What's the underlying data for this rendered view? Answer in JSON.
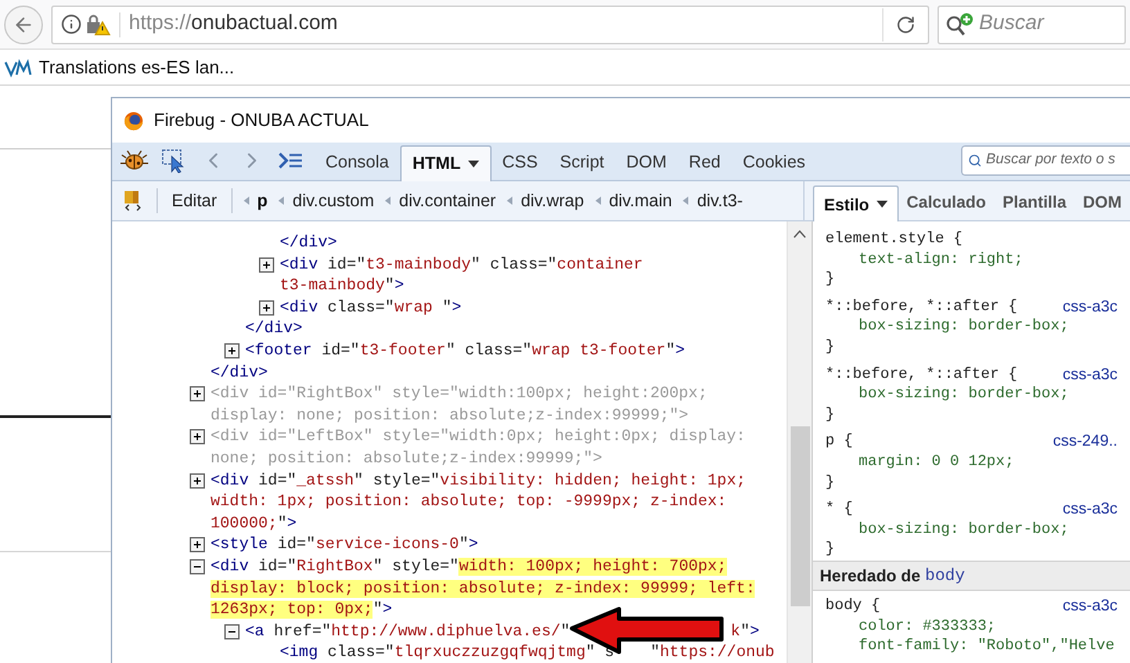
{
  "browser": {
    "url": {
      "scheme": "https://",
      "host": "onubactual.com"
    },
    "search": {
      "placeholder": "Buscar"
    },
    "bookmarks": [
      {
        "label": "Translations es-ES lan..."
      }
    ]
  },
  "firebug": {
    "title": "Firebug - ONUBA ACTUAL",
    "tabs": [
      {
        "label": "Consola",
        "selected": false,
        "dropdown": false
      },
      {
        "label": "HTML",
        "selected": true,
        "dropdown": true
      },
      {
        "label": "CSS",
        "selected": false,
        "dropdown": false
      },
      {
        "label": "Script",
        "selected": false,
        "dropdown": false
      },
      {
        "label": "DOM",
        "selected": false,
        "dropdown": false
      },
      {
        "label": "Red",
        "selected": false,
        "dropdown": false
      },
      {
        "label": "Cookies",
        "selected": false,
        "dropdown": false
      }
    ],
    "edit_button": "Editar",
    "breadcrumbs": [
      {
        "label": "p",
        "selected": true
      },
      {
        "label": "div.custom",
        "selected": false
      },
      {
        "label": "div.container",
        "selected": false
      },
      {
        "label": "div.wrap",
        "selected": false
      },
      {
        "label": "div.main",
        "selected": false
      },
      {
        "label": "div.t3-",
        "selected": false
      }
    ],
    "html_tree": [
      {
        "children": [
          {
            "children": [
              {
                "children": [
                  {
                    "lines": [
                      {
                        "segments": [
                          {
                            "kind": "tag",
                            "text": "</div>"
                          }
                        ]
                      }
                    ]
                  },
                  {
                    "expanded": false,
                    "lines": [
                      {
                        "segments": [
                          {
                            "kind": "tag",
                            "text": "<div"
                          },
                          {
                            "kind": "attr",
                            "text": " id=\""
                          },
                          {
                            "kind": "value",
                            "text": "t3-mainbody"
                          },
                          {
                            "kind": "attr",
                            "text": "\" class=\""
                          },
                          {
                            "kind": "value",
                            "text": "container"
                          }
                        ]
                      },
                      {
                        "segments": [
                          {
                            "kind": "value",
                            "text": "t3-mainbody"
                          },
                          {
                            "kind": "attr",
                            "text": "\""
                          },
                          {
                            "kind": "tag",
                            "text": ">"
                          }
                        ]
                      }
                    ]
                  },
                  {
                    "expanded": false,
                    "lines": [
                      {
                        "segments": [
                          {
                            "kind": "tag",
                            "text": "<div"
                          },
                          {
                            "kind": "attr",
                            "text": " class=\""
                          },
                          {
                            "kind": "value",
                            "text": "wrap "
                          },
                          {
                            "kind": "attr",
                            "text": "\""
                          },
                          {
                            "kind": "tag",
                            "text": ">"
                          }
                        ]
                      }
                    ]
                  }
                ]
              },
              {
                "lines": [
                  {
                    "segments": [
                      {
                        "kind": "tag",
                        "text": "</div>"
                      }
                    ]
                  }
                ]
              },
              {
                "expanded": false,
                "lines": [
                  {
                    "segments": [
                      {
                        "kind": "tag",
                        "text": "<footer"
                      },
                      {
                        "kind": "attr",
                        "text": " id=\""
                      },
                      {
                        "kind": "value",
                        "text": "t3-footer"
                      },
                      {
                        "kind": "attr",
                        "text": "\" class=\""
                      },
                      {
                        "kind": "value",
                        "text": "wrap t3-footer"
                      },
                      {
                        "kind": "attr",
                        "text": "\""
                      },
                      {
                        "kind": "tag",
                        "text": ">"
                      }
                    ]
                  }
                ]
              }
            ]
          },
          {
            "lines": [
              {
                "segments": [
                  {
                    "kind": "tag",
                    "text": "</div>"
                  }
                ]
              }
            ]
          },
          {
            "expanded": false,
            "lines": [
              {
                "segments": [
                  {
                    "kind": "muted",
                    "text": "<div id=\"RightBox\" style=\"width:100px; height:200px;"
                  }
                ]
              },
              {
                "segments": [
                  {
                    "kind": "muted",
                    "text": "display: none; position: absolute;z-index:99999;\">"
                  }
                ]
              }
            ]
          },
          {
            "expanded": false,
            "lines": [
              {
                "segments": [
                  {
                    "kind": "muted",
                    "text": "<div id=\"LeftBox\" style=\"width:0px; height:0px; display:"
                  }
                ]
              },
              {
                "segments": [
                  {
                    "kind": "muted",
                    "text": "none; position: absolute;z-index:99999;\">"
                  }
                ]
              }
            ]
          },
          {
            "expanded": false,
            "lines": [
              {
                "segments": [
                  {
                    "kind": "tag",
                    "text": "<div"
                  },
                  {
                    "kind": "attr",
                    "text": " id=\""
                  },
                  {
                    "kind": "value",
                    "text": "_atssh"
                  },
                  {
                    "kind": "attr",
                    "text": "\" style=\""
                  },
                  {
                    "kind": "value",
                    "text": "visibility: hidden; height: 1px;"
                  }
                ]
              },
              {
                "segments": [
                  {
                    "kind": "value",
                    "text": "width: 1px; position: absolute; top: -9999px; z-index:"
                  }
                ]
              },
              {
                "segments": [
                  {
                    "kind": "value",
                    "text": "100000;"
                  },
                  {
                    "kind": "attr",
                    "text": "\""
                  },
                  {
                    "kind": "tag",
                    "text": ">"
                  }
                ]
              }
            ]
          },
          {
            "expanded": false,
            "lines": [
              {
                "segments": [
                  {
                    "kind": "tag",
                    "text": "<style"
                  },
                  {
                    "kind": "attr",
                    "text": " id=\""
                  },
                  {
                    "kind": "value",
                    "text": "service-icons-0"
                  },
                  {
                    "kind": "attr",
                    "text": "\""
                  },
                  {
                    "kind": "tag",
                    "text": ">"
                  }
                ]
              }
            ]
          },
          {
            "expanded": true,
            "lines": [
              {
                "segments": [
                  {
                    "kind": "tag",
                    "text": "<div"
                  },
                  {
                    "kind": "attr",
                    "text": " id=\""
                  },
                  {
                    "kind": "value",
                    "text": "RightBox"
                  },
                  {
                    "kind": "attr",
                    "text": "\" style=\""
                  },
                  {
                    "kind": "highlight",
                    "text": "width: 100px; height: 700px;"
                  }
                ]
              },
              {
                "segments": [
                  {
                    "kind": "highlight",
                    "text": "display: block; position: absolute; z-index: 99999; left:"
                  }
                ]
              },
              {
                "segments": [
                  {
                    "kind": "highlight",
                    "text": "1263px; top: 0px;"
                  },
                  {
                    "kind": "attr",
                    "text": "\""
                  },
                  {
                    "kind": "tag",
                    "text": ">"
                  }
                ]
              }
            ],
            "children": [
              {
                "expanded": true,
                "lines": [
                  {
                    "segments": [
                      {
                        "kind": "tag",
                        "text": "<a"
                      },
                      {
                        "kind": "attr",
                        "text": " href=\""
                      },
                      {
                        "kind": "value",
                        "text": "http://www.diphuelva.es/"
                      },
                      {
                        "kind": "attr",
                        "text": "\""
                      }
                    ],
                    "tail": [
                      {
                        "kind": "value",
                        "text": "k"
                      },
                      {
                        "kind": "attr",
                        "text": "\""
                      },
                      {
                        "kind": "tag",
                        "text": ">"
                      }
                    ]
                  }
                ],
                "children": [
                  {
                    "lines": [
                      {
                        "segments": [
                          {
                            "kind": "tag",
                            "text": "<img"
                          },
                          {
                            "kind": "attr",
                            "text": " class=\""
                          },
                          {
                            "kind": "value",
                            "text": "tlqrxuczzuzgqfwqjtmg"
                          },
                          {
                            "kind": "attr",
                            "text": "\" s"
                          }
                        ],
                        "tail": [
                          {
                            "kind": "attr",
                            "text": "\""
                          },
                          {
                            "kind": "value",
                            "text": "https://onub"
                          }
                        ]
                      }
                    ]
                  }
                ]
              }
            ]
          }
        ]
      }
    ],
    "side_search": {
      "placeholder": "Buscar por texto o s"
    },
    "side_tabs": [
      {
        "label": "Estilo",
        "selected": true,
        "dropdown": true
      },
      {
        "label": "Calculado",
        "selected": false,
        "dropdown": false
      },
      {
        "label": "Plantilla",
        "selected": false,
        "dropdown": false
      },
      {
        "label": "DOM",
        "selected": false,
        "dropdown": false
      }
    ],
    "rules": [
      {
        "selector": "element.style {",
        "declarations": [
          {
            "text": "text-align: right;"
          }
        ],
        "close": "}"
      },
      {
        "selector": "*::before, *::after {",
        "source": "css-a3c",
        "declarations": [
          {
            "text": "box-sizing: border-box;"
          }
        ],
        "close": "}"
      },
      {
        "selector": "*::before, *::after {",
        "source": "css-a3c",
        "declarations": [
          {
            "text": "box-sizing: border-box;"
          }
        ],
        "close": "}"
      },
      {
        "selector": "p {",
        "source": "css-249..",
        "declarations": [
          {
            "text": "margin: 0 0 12px;"
          }
        ],
        "close": "}"
      },
      {
        "selector": "* {",
        "source": "css-a3c",
        "declarations": [
          {
            "text": "box-sizing: border-box;"
          }
        ],
        "close": "}"
      }
    ],
    "inherited": {
      "prefix": "Heredado de",
      "element": "body"
    },
    "inherited_rules": [
      {
        "selector": "body {",
        "source": "css-a3c",
        "declarations": [
          {
            "text": "color: #333333;"
          },
          {
            "text": "font-family: \"Roboto\",\"Helve"
          }
        ]
      }
    ]
  }
}
